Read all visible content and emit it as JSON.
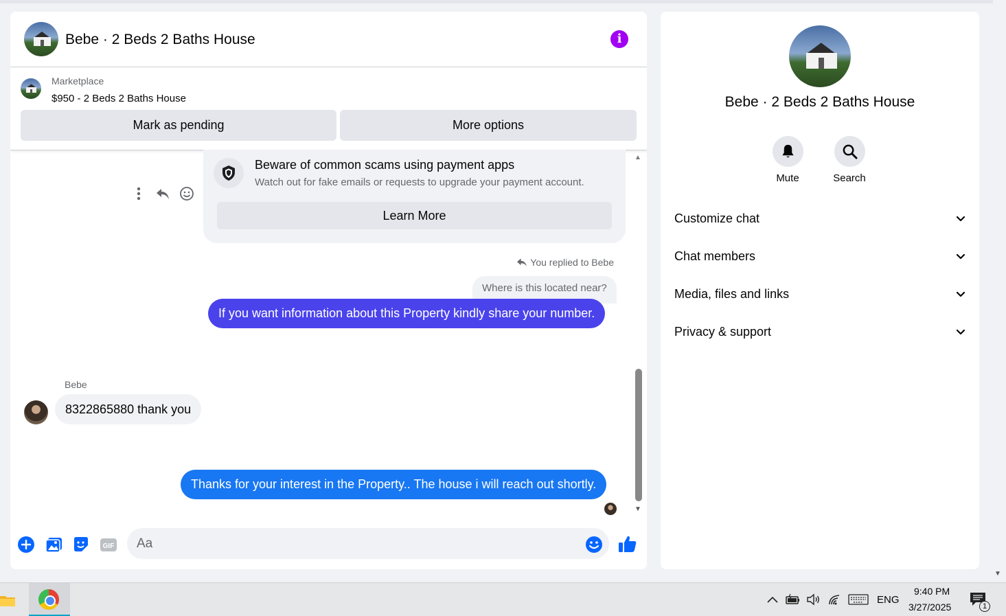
{
  "chat": {
    "title": "Bebe · 2 Beds 2 Baths House",
    "listing": {
      "source": "Marketplace",
      "title": "$950 - 2 Beds 2 Baths House"
    },
    "buttons": {
      "mark_pending": "Mark as pending",
      "more_options": "More options"
    },
    "scam_notice": {
      "title": "Beware of common scams using payment apps",
      "subtitle": "Watch out for fake emails or requests to upgrade your payment account.",
      "button": "Learn More"
    },
    "messages": {
      "replied_label": "You replied to Bebe",
      "quoted_text": "Where is this located near?",
      "outgoing_1": "If you want information about this Property kindly share your number.",
      "incoming_sender": "Bebe",
      "incoming_1": "8322865880 thank you",
      "outgoing_2": "Thanks for your interest in the Property.. The house i will reach  out shortly."
    },
    "composer": {
      "placeholder": "Aa",
      "gif_label": "GIF"
    }
  },
  "info_panel": {
    "title": "Bebe · 2 Beds 2 Baths House",
    "actions": [
      {
        "label": "Mute",
        "icon": "bell-icon"
      },
      {
        "label": "Search",
        "icon": "search-icon"
      }
    ],
    "sections": [
      {
        "label": "Customize chat"
      },
      {
        "label": "Chat members"
      },
      {
        "label": "Media, files and links"
      },
      {
        "label": "Privacy & support"
      }
    ]
  },
  "taskbar": {
    "language": "ENG",
    "time": "9:40 PM",
    "date": "3/27/2025",
    "notification_count": "1"
  },
  "colors": {
    "accent_purple": "#a100f2",
    "bubble_purple": "#4a43ec",
    "bubble_blue": "#1877f2",
    "icon_blue": "#0866ff"
  }
}
